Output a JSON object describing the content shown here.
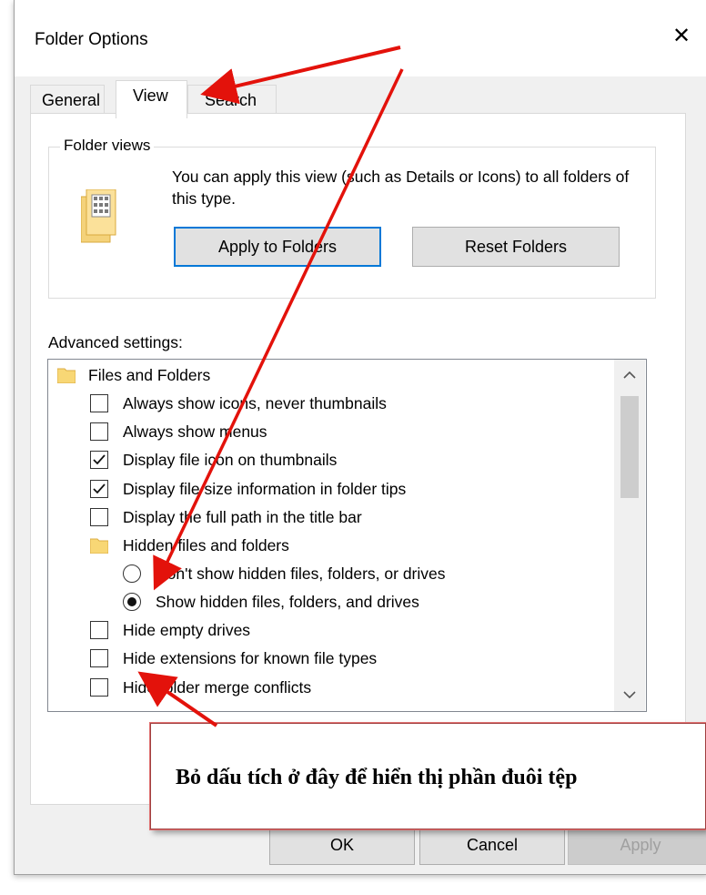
{
  "window": {
    "title": "Folder Options",
    "close_glyph": "✕"
  },
  "tabs": [
    {
      "label": "General",
      "active": false
    },
    {
      "label": "View",
      "active": true
    },
    {
      "label": "Search",
      "active": false
    }
  ],
  "folder_views": {
    "label": "Folder views",
    "description": "You can apply this view (such as Details or Icons) to all folders of this type.",
    "apply_button": "Apply to Folders",
    "reset_button": "Reset Folders"
  },
  "advanced": {
    "label": "Advanced settings:",
    "items": [
      {
        "type": "folder",
        "label": "Files and Folders"
      },
      {
        "type": "checkbox",
        "label": "Always show icons, never thumbnails",
        "checked": false
      },
      {
        "type": "checkbox",
        "label": "Always show menus",
        "checked": false
      },
      {
        "type": "checkbox",
        "label": "Display file icon on thumbnails",
        "checked": true
      },
      {
        "type": "checkbox",
        "label": "Display file size information in folder tips",
        "checked": true
      },
      {
        "type": "checkbox",
        "label": "Display the full path in the title bar",
        "checked": false
      },
      {
        "type": "folder",
        "label": "Hidden files and folders"
      },
      {
        "type": "radio",
        "label": "Don't show hidden files, folders, or drives",
        "selected": false
      },
      {
        "type": "radio",
        "label": "Show hidden files, folders, and drives",
        "selected": true
      },
      {
        "type": "checkbox",
        "label": "Hide empty drives",
        "checked": false
      },
      {
        "type": "checkbox",
        "label": "Hide extensions for known file types",
        "checked": false
      },
      {
        "type": "checkbox",
        "label": "Hide folder merge conflicts",
        "checked": false
      }
    ]
  },
  "buttons": {
    "ok": "OK",
    "cancel": "Cancel",
    "apply": "Apply"
  },
  "callout": {
    "text": "Bỏ dấu tích ở đây để hiển thị phần đuôi tệp"
  },
  "colors": {
    "accent": "#0078d7",
    "annotation_arrow": "#e3120b"
  }
}
